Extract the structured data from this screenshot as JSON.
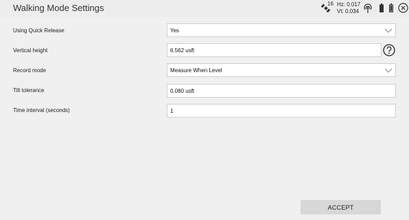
{
  "header": {
    "title": "Walking Mode Settings",
    "satellite_icon": "satellite-icon",
    "satellite_count": "16",
    "hz_precision": "Hz: 0.017",
    "vt_precision": "Vt: 0.034",
    "radio_icon": "radio-signal-icon",
    "battery_icons": [
      "battery-icon",
      "battery-icon"
    ],
    "close_icon": "close-icon"
  },
  "form": {
    "quick_release": {
      "label": "Using Quick Release",
      "value": "Yes"
    },
    "vertical_height": {
      "label": "Vertical height",
      "value": "6.562 usft"
    },
    "record_mode": {
      "label": "Record mode",
      "value": "Measure When Level"
    },
    "tilt_tolerance": {
      "label": "Tilt tolerance",
      "value": "0.080 usft"
    },
    "time_interval": {
      "label": "Time interval (seconds)",
      "value": "1"
    }
  },
  "footer": {
    "accept_label": "ACCEPT"
  }
}
